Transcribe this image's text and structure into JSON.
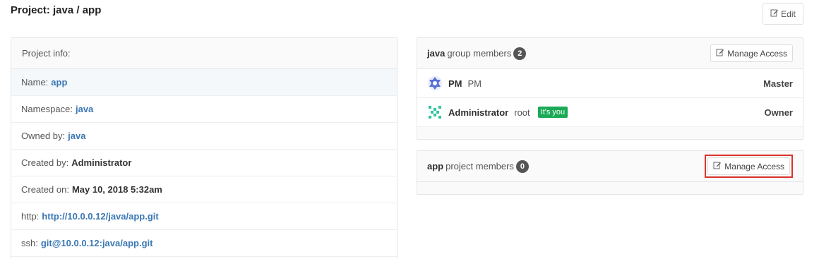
{
  "page": {
    "title": "Project: java / app",
    "edit_label": "Edit"
  },
  "project_info": {
    "heading": "Project info:",
    "rows": [
      {
        "label": "Name:",
        "value": "app"
      },
      {
        "label": "Namespace:",
        "value": "java"
      },
      {
        "label": "Owned by:",
        "value": "java"
      },
      {
        "label": "Created by:",
        "value": "Administrator"
      },
      {
        "label": "Created on:",
        "value": "May 10, 2018 5:32am"
      },
      {
        "label": "http:",
        "value": "http://10.0.0.12/java/app.git"
      },
      {
        "label": "ssh:",
        "value": "git@10.0.0.12:java/app.git"
      }
    ]
  },
  "group_members": {
    "name": "java",
    "label": "group members",
    "count": "2",
    "manage_label": "Manage Access",
    "members": [
      {
        "name": "PM",
        "username": "PM",
        "role": "Master",
        "badge": ""
      },
      {
        "name": "Administrator",
        "username": "root",
        "role": "Owner",
        "badge": "It's you"
      }
    ]
  },
  "project_members": {
    "name": "app",
    "label": "project members",
    "count": "0",
    "manage_label": "Manage Access"
  },
  "colors": {
    "link": "#3a77b3",
    "badge_green": "#1aaa55",
    "highlight_red": "#d9342e"
  }
}
